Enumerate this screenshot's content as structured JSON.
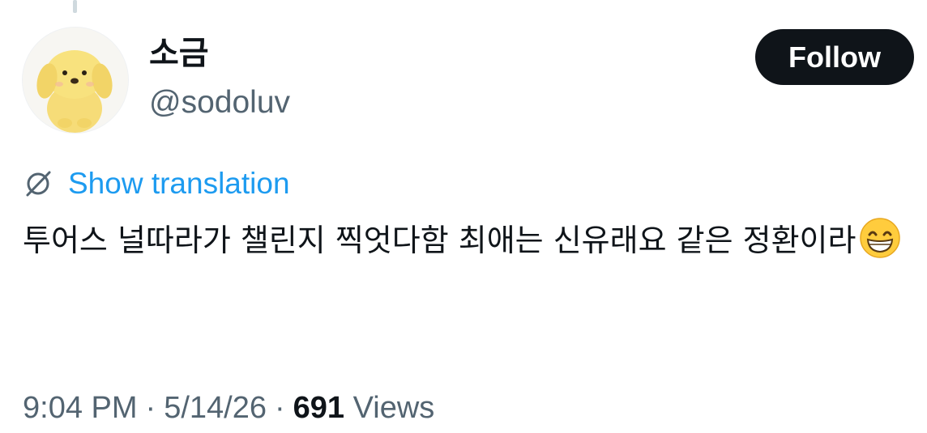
{
  "author": {
    "display_name": "소금",
    "handle": "@sodoluv",
    "avatar_icon": "yellow-puppy-plush-avatar"
  },
  "follow_button": {
    "label": "Follow"
  },
  "translation": {
    "label": "Show translation",
    "icon": "globe-slash-icon"
  },
  "tweet": {
    "text": "투어스 널따라가 챌린지 찍엇다함 최애는 신유래요 같은 정환이라",
    "emoji": "grinning-face-with-smiling-eyes"
  },
  "meta": {
    "time": "9:04 PM",
    "date": "5/14/26",
    "separator": "·",
    "views_count": "691",
    "views_label": "Views"
  },
  "colors": {
    "link": "#1d9bf0",
    "secondary_text": "#536471",
    "primary_text": "#0f1419",
    "follow_bg": "#0f1419"
  }
}
